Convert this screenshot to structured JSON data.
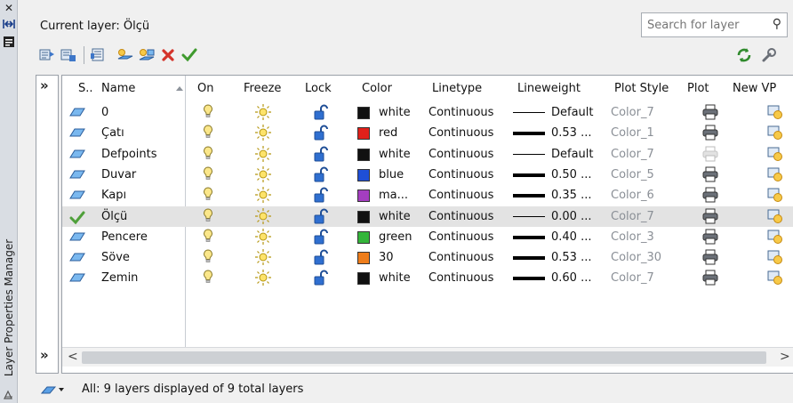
{
  "palette": {
    "title": "Layer Properties Manager",
    "close_icon": "close-icon",
    "autohide_icon": "autohide-icon",
    "properties_icon": "properties-icon",
    "expand_left": "»",
    "collapse_left": "»"
  },
  "header": {
    "current_layer": "Current layer: Ölçü",
    "search_placeholder": "Search for layer"
  },
  "toolbar": {
    "buttons": [
      "new-property-filter-icon",
      "new-group-filter-icon",
      "layer-states-manager-icon",
      "new-layer-icon",
      "new-layer-vp-frozen-icon",
      "delete-layer-icon",
      "set-current-icon"
    ],
    "right_buttons": [
      "refresh-icon",
      "settings-icon"
    ]
  },
  "columns": [
    "S..",
    "Name",
    "On",
    "Freeze",
    "Lock",
    "Color",
    "Linetype",
    "Lineweight",
    "Plot Style",
    "Plot",
    "New VP"
  ],
  "layers": [
    {
      "name": "0",
      "color_name": "white",
      "color_hex": "#111111",
      "linetype": "Continuous",
      "lineweight": "Default",
      "lw_thick": false,
      "plot_style": "Color_7",
      "plottable": true,
      "current": false
    },
    {
      "name": "Çatı",
      "color_name": "red",
      "color_hex": "#e0201a",
      "linetype": "Continuous",
      "lineweight": "0.53 ...",
      "lw_thick": true,
      "plot_style": "Color_1",
      "plottable": true,
      "current": false
    },
    {
      "name": "Defpoints",
      "color_name": "white",
      "color_hex": "#111111",
      "linetype": "Continuous",
      "lineweight": "Default",
      "lw_thick": false,
      "plot_style": "Color_7",
      "plottable": false,
      "current": false
    },
    {
      "name": "Duvar",
      "color_name": "blue",
      "color_hex": "#1f4fd6",
      "linetype": "Continuous",
      "lineweight": "0.50 ...",
      "lw_thick": true,
      "plot_style": "Color_5",
      "plottable": true,
      "current": false
    },
    {
      "name": "Kapı",
      "color_name": "ma...",
      "color_hex": "#a43ec0",
      "linetype": "Continuous",
      "lineweight": "0.35 ...",
      "lw_thick": true,
      "plot_style": "Color_6",
      "plottable": true,
      "current": false
    },
    {
      "name": "Ölçü",
      "color_name": "white",
      "color_hex": "#111111",
      "linetype": "Continuous",
      "lineweight": "0.00 ...",
      "lw_thick": false,
      "plot_style": "Color_7",
      "plottable": true,
      "current": true
    },
    {
      "name": "Pencere",
      "color_name": "green",
      "color_hex": "#34b53a",
      "linetype": "Continuous",
      "lineweight": "0.40 ...",
      "lw_thick": true,
      "plot_style": "Color_3",
      "plottable": true,
      "current": false
    },
    {
      "name": "Söve",
      "color_name": "30",
      "color_hex": "#ee7d1b",
      "linetype": "Continuous",
      "lineweight": "0.53 ...",
      "lw_thick": true,
      "plot_style": "Color_30",
      "plottable": true,
      "current": false
    },
    {
      "name": "Zemin",
      "color_name": "white",
      "color_hex": "#111111",
      "linetype": "Continuous",
      "lineweight": "0.60 ...",
      "lw_thick": true,
      "plot_style": "Color_7",
      "plottable": true,
      "current": false
    }
  ],
  "scrollbar": {
    "left": "<",
    "right": ">"
  },
  "status": {
    "text": "All: 9 layers displayed of 9 total layers",
    "icon": "filter-icon"
  }
}
